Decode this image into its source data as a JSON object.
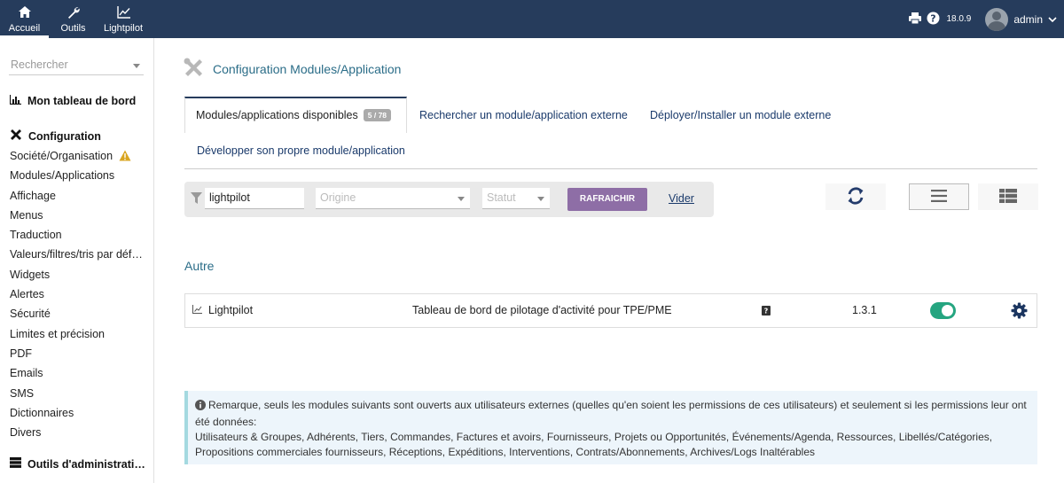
{
  "topnav": {
    "items": [
      {
        "label": "Accueil",
        "icon": "home-icon"
      },
      {
        "label": "Outils",
        "icon": "wrench-icon"
      },
      {
        "label": "Lightpilot",
        "icon": "line-chart-icon"
      }
    ],
    "version": "18.0.9",
    "user": "admin"
  },
  "sidebar": {
    "search_placeholder": "Rechercher",
    "dashboard": "Mon tableau de bord",
    "config_title": "Configuration",
    "items": [
      "Société/Organisation",
      "Modules/Applications",
      "Affichage",
      "Menus",
      "Traduction",
      "Valeurs/filtres/tris par déf…",
      "Widgets",
      "Alertes",
      "Sécurité",
      "Limites et précision",
      "PDF",
      "Emails",
      "SMS",
      "Dictionnaires",
      "Divers"
    ],
    "admin_tools": "Outils d'administrati…"
  },
  "page": {
    "title": "Configuration Modules/Application",
    "tabs": [
      {
        "label": "Modules/applications disponibles",
        "badge": "5 / 78"
      },
      {
        "label": "Rechercher un module/application externe"
      },
      {
        "label": "Déployer/Installer un module externe"
      },
      {
        "label": "Développer son propre module/application"
      }
    ],
    "filter": {
      "search_value": "lightpilot",
      "origin_placeholder": "Origine",
      "status_placeholder": "Statut",
      "refresh_label": "RAFRAICHIR",
      "clear_label": "Vider"
    },
    "section": "Autre",
    "modules": [
      {
        "name": "Lightpilot",
        "description": "Tableau de bord de pilotage d'activité pour TPE/PME",
        "version": "1.3.1",
        "enabled": true
      }
    ],
    "notice": {
      "line1": "Remarque, seuls les modules suivants sont ouverts aux utilisateurs externes (quelles qu'en soient les permissions de ces utilisateurs) et seulement si les permissions leur ont été données:",
      "line2": "Utilisateurs & Groupes, Adhérents, Tiers, Commandes, Factures et avoirs, Fournisseurs, Projets ou Opportunités, Événements/Agenda, Ressources, Libellés/Catégories, Propositions commerciales fournisseurs, Réceptions, Expéditions, Interventions, Contrats/Abonnements, Archives/Logs Inaltérables"
    }
  },
  "colors": {
    "topbar": "#263c5c",
    "accent_teal": "#2b6d88",
    "button_purple": "#8e6ea6",
    "toggle_green": "#25a580",
    "link_blue": "#1a3a6b"
  }
}
